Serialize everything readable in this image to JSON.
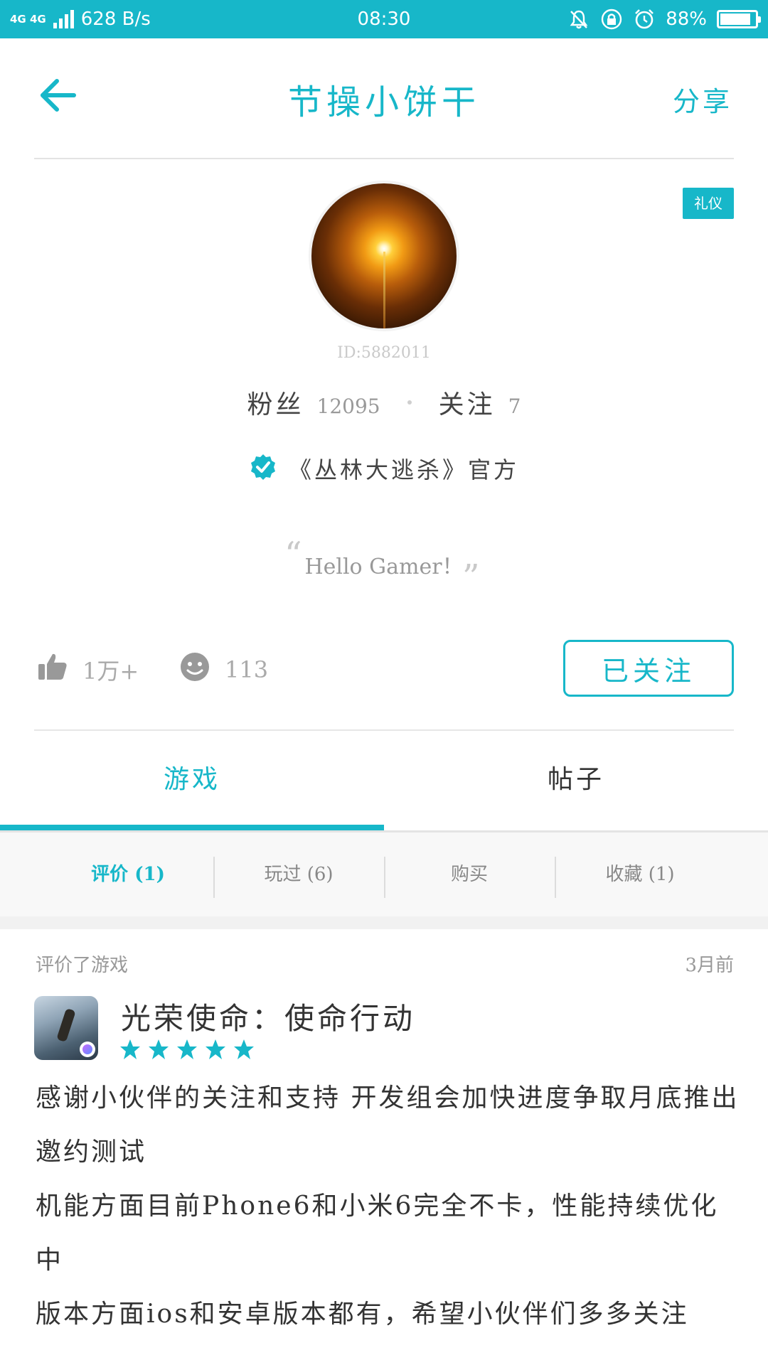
{
  "theme": {
    "accent": "#17b7c9",
    "text": "#333333",
    "muted": "#999999"
  },
  "status_bar": {
    "network": "4G 4G",
    "speed": "628 B/s",
    "time": "08:30",
    "battery": "88%",
    "battery_level": 0.88,
    "icons": [
      "signal-icon",
      "bell-muted-icon",
      "rotation-lock-icon",
      "alarm-icon",
      "battery-icon"
    ]
  },
  "header": {
    "title": "节操小饼干",
    "share_label": "分享",
    "back_icon": "back-arrow-icon"
  },
  "profile": {
    "badge": "礼仪",
    "user_id": "ID:5882011",
    "fans_label": "粉丝",
    "fans_count": "12095",
    "following_label": "关注",
    "following_count": "7",
    "official_text": "《丛林大逃杀》官方",
    "official_icon": "verified-check-icon",
    "quote": "Hello Gamer！",
    "likes": "1万+",
    "smiles": "113",
    "like_icon": "thumbs-up-icon",
    "smile_icon": "smiley-icon",
    "follow_button": "已关注"
  },
  "tabs": [
    {
      "label": "游戏",
      "active": true
    },
    {
      "label": "帖子",
      "active": false
    }
  ],
  "subtabs": [
    {
      "label": "评价",
      "count": "(1)",
      "active": true
    },
    {
      "label": "玩过",
      "count": "(6)",
      "active": false
    },
    {
      "label": "购买",
      "count": "",
      "active": false
    },
    {
      "label": "收藏",
      "count": "(1)",
      "active": false
    }
  ],
  "review": {
    "action": "评价了游戏",
    "time": "3月前",
    "game_title": "光荣使命：使命行动",
    "rating": 5,
    "rating_max": 5,
    "lines": [
      "感谢小伙伴的关注和支持 开发组会加快进度争取月底推出邀约测试",
      "机能方面目前Phone6和小米6完全不卡，性能持续优化中",
      "版本方面ios和安卓版本都有，希望小伙伴们多多关注"
    ]
  }
}
